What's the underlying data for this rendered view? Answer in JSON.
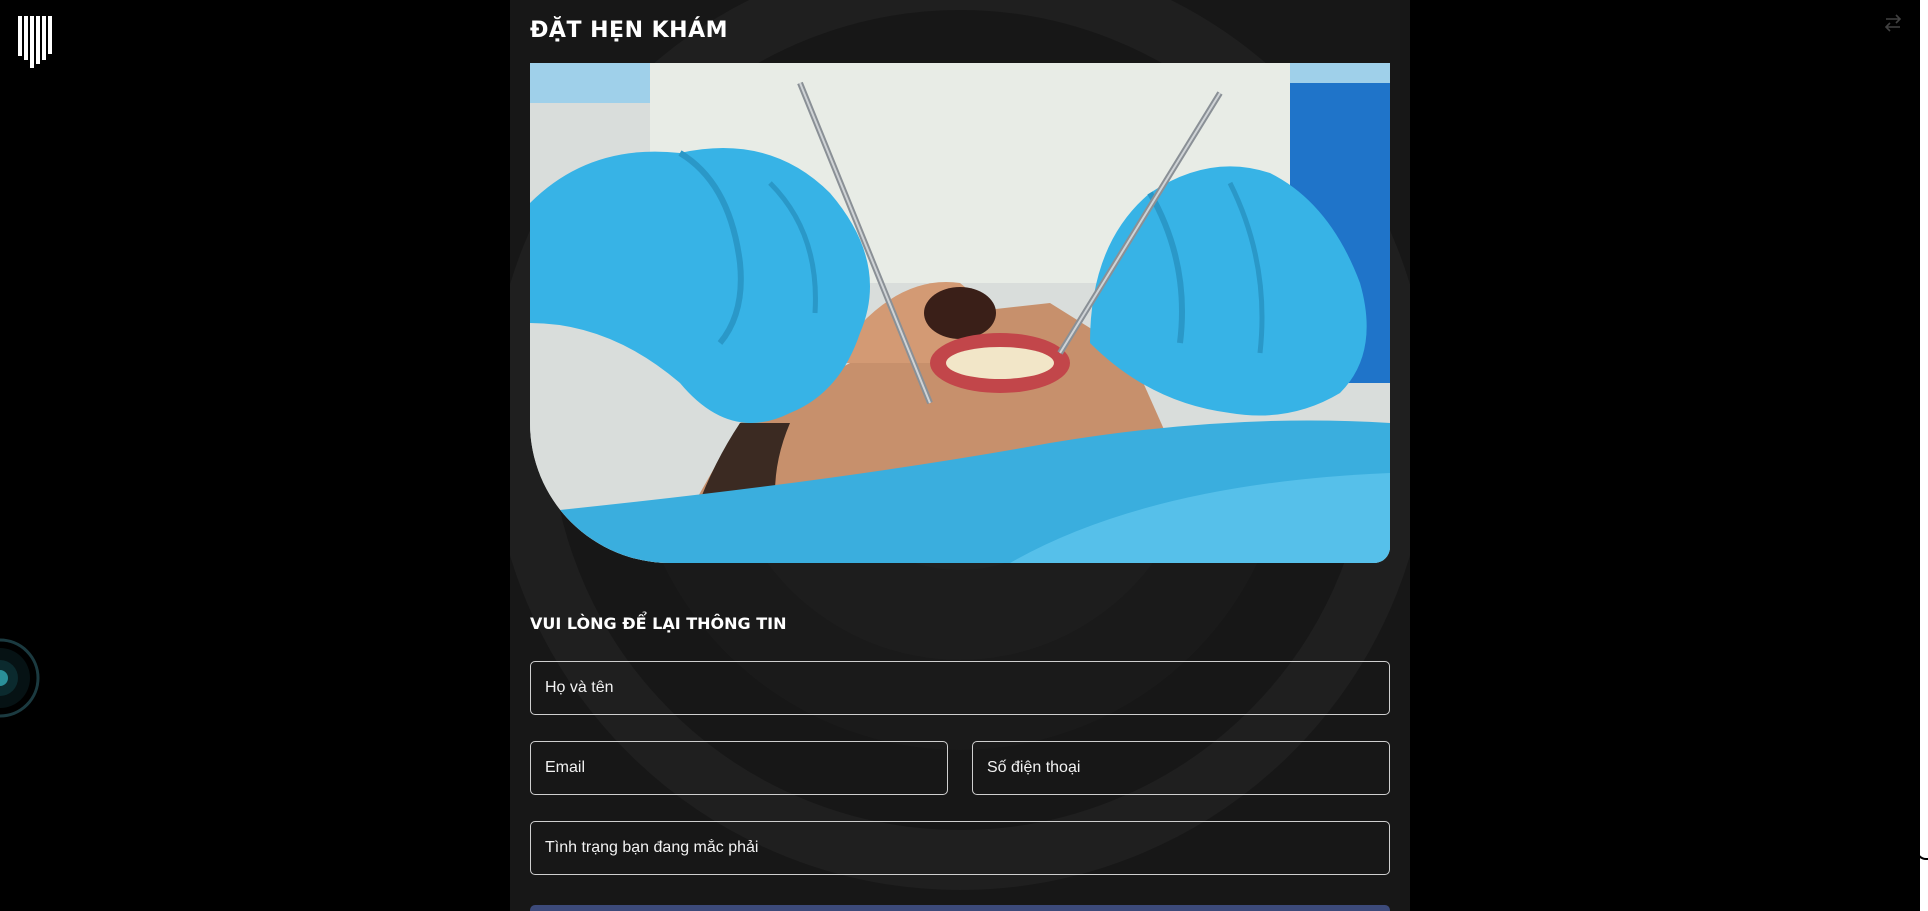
{
  "logo": {
    "icon": "bars-logo-icon"
  },
  "top_right": {
    "icon": "swap-arrows-icon"
  },
  "side_widget": {
    "icon": "orb-icon"
  },
  "form": {
    "title": "ĐẶT HẸN KHÁM",
    "hero_image": {
      "icon": "dental-exam-photo"
    },
    "subtitle": "VUI LÒNG ĐỂ LẠI THÔNG TIN",
    "fields": {
      "name_placeholder": "Họ và tên",
      "email_placeholder": "Email",
      "phone_placeholder": "Số điện thoại",
      "condition_placeholder": "Tình trạng bạn đang mắc phải"
    }
  },
  "colors": {
    "page_background": "#000000",
    "panel_background": "#171717",
    "text": "#ffffff",
    "field_border": "#cfcfcf",
    "submit_button": "#3c4a7a",
    "glove_blue": "#37b3e6"
  }
}
